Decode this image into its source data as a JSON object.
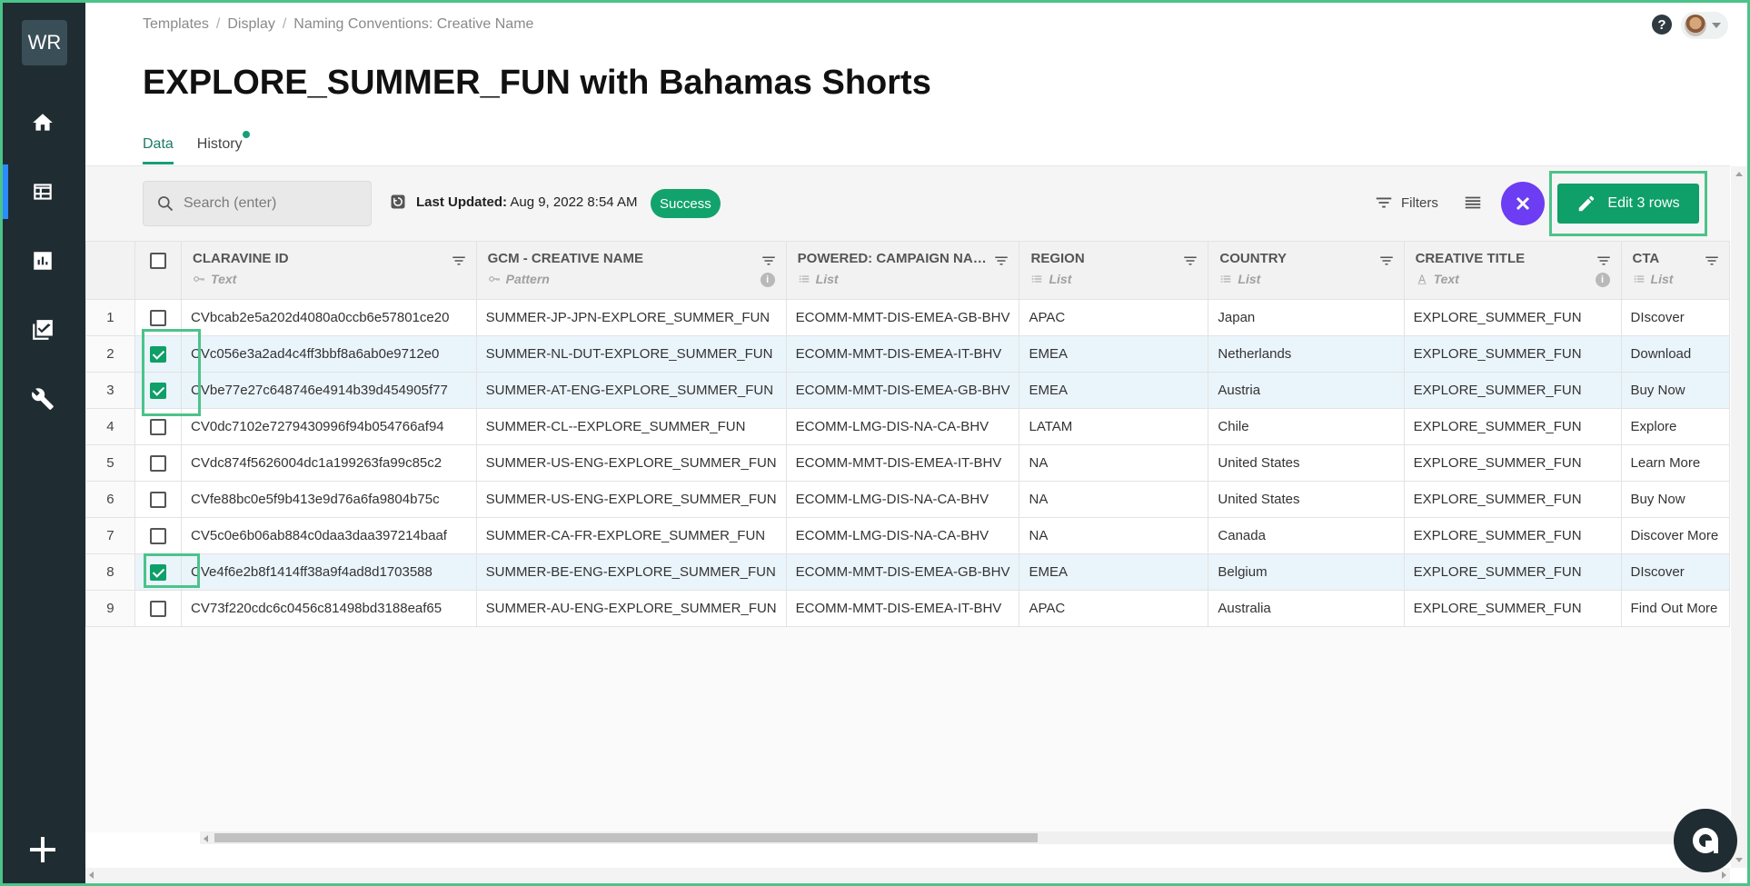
{
  "sidebar": {
    "logo": "WR",
    "items": [
      {
        "name": "home",
        "icon": "home-icon"
      },
      {
        "name": "templates",
        "icon": "table-icon",
        "active": true
      },
      {
        "name": "reports",
        "icon": "bar-chart-icon"
      },
      {
        "name": "approvals",
        "icon": "checklist-icon"
      },
      {
        "name": "settings",
        "icon": "wrench-icon"
      }
    ],
    "add_icon": "plus-icon"
  },
  "header": {
    "breadcrumb": [
      "Templates",
      "Display",
      "Naming Conventions: Creative Name"
    ],
    "title": "EXPLORE_SUMMER_FUN with Bahamas Shorts",
    "tabs": [
      {
        "label": "Data",
        "active": true
      },
      {
        "label": "History",
        "dot": true
      }
    ]
  },
  "toolbar": {
    "search_placeholder": "Search (enter)",
    "last_updated_label": "Last Updated:",
    "last_updated_value": "Aug 9, 2022 8:54 AM",
    "status_badge": "Success",
    "filters_label": "Filters",
    "edit_label": "Edit 3 rows",
    "accent": "#0f9f68",
    "close_color": "#6c3df2"
  },
  "table": {
    "columns": [
      {
        "name": "CLARAVINE ID",
        "type": "Text",
        "type_icon": "key-icon",
        "info": false
      },
      {
        "name": "GCM - CREATIVE NAME",
        "type": "Pattern",
        "type_icon": "key-icon",
        "info": true
      },
      {
        "name": "POWERED: CAMPAIGN NAME",
        "type": "List",
        "type_icon": "list-icon",
        "info": false
      },
      {
        "name": "REGION",
        "type": "List",
        "type_icon": "list-icon",
        "info": false
      },
      {
        "name": "COUNTRY",
        "type": "List",
        "type_icon": "list-icon",
        "info": false
      },
      {
        "name": "CREATIVE TITLE",
        "type": "Text",
        "type_icon": "text-icon",
        "info": true
      },
      {
        "name": "CTA",
        "type": "List",
        "type_icon": "list-icon",
        "info": false
      }
    ],
    "rows": [
      {
        "num": "1",
        "checked": false,
        "cells": [
          "CVbcab2e5a202d4080a0ccb6e57801ce20",
          "SUMMER-JP-JPN-EXPLORE_SUMMER_FUN",
          "ECOMM-MMT-DIS-EMEA-GB-BHV",
          "APAC",
          "Japan",
          "EXPLORE_SUMMER_FUN",
          "DIscover"
        ]
      },
      {
        "num": "2",
        "checked": true,
        "cells": [
          "CVc056e3a2ad4c4ff3bbf8a6ab0e9712e0",
          "SUMMER-NL-DUT-EXPLORE_SUMMER_FUN",
          "ECOMM-MMT-DIS-EMEA-IT-BHV",
          "EMEA",
          "Netherlands",
          "EXPLORE_SUMMER_FUN",
          "Download"
        ]
      },
      {
        "num": "3",
        "checked": true,
        "cells": [
          "CVbe77e27c648746e4914b39d454905f77",
          "SUMMER-AT-ENG-EXPLORE_SUMMER_FUN",
          "ECOMM-MMT-DIS-EMEA-GB-BHV",
          "EMEA",
          "Austria",
          "EXPLORE_SUMMER_FUN",
          "Buy Now"
        ]
      },
      {
        "num": "4",
        "checked": false,
        "cells": [
          "CV0dc7102e7279430996f94b054766af94",
          "SUMMER-CL--EXPLORE_SUMMER_FUN",
          "ECOMM-LMG-DIS-NA-CA-BHV",
          "LATAM",
          "Chile",
          "EXPLORE_SUMMER_FUN",
          "Explore"
        ]
      },
      {
        "num": "5",
        "checked": false,
        "cells": [
          "CVdc874f5626004dc1a199263fa99c85c2",
          "SUMMER-US-ENG-EXPLORE_SUMMER_FUN",
          "ECOMM-MMT-DIS-EMEA-IT-BHV",
          "NA",
          "United States",
          "EXPLORE_SUMMER_FUN",
          "Learn More"
        ]
      },
      {
        "num": "6",
        "checked": false,
        "cells": [
          "CVfe88bc0e5f9b413e9d76a6fa9804b75c",
          "SUMMER-US-ENG-EXPLORE_SUMMER_FUN",
          "ECOMM-LMG-DIS-NA-CA-BHV",
          "NA",
          "United States",
          "EXPLORE_SUMMER_FUN",
          "Buy Now"
        ]
      },
      {
        "num": "7",
        "checked": false,
        "cells": [
          "CV5c0e6b06ab884c0daa3daa397214baaf",
          "SUMMER-CA-FR-EXPLORE_SUMMER_FUN",
          "ECOMM-LMG-DIS-NA-CA-BHV",
          "NA",
          "Canada",
          "EXPLORE_SUMMER_FUN",
          "Discover More"
        ]
      },
      {
        "num": "8",
        "checked": true,
        "cells": [
          "CVe4f6e2b8f1414ff38a9f4ad8d1703588",
          "SUMMER-BE-ENG-EXPLORE_SUMMER_FUN",
          "ECOMM-MMT-DIS-EMEA-GB-BHV",
          "EMEA",
          "Belgium",
          "EXPLORE_SUMMER_FUN",
          "DIscover"
        ]
      },
      {
        "num": "9",
        "checked": false,
        "cells": [
          "CV73f220cdc6c0456c81498bd3188eaf65",
          "SUMMER-AU-ENG-EXPLORE_SUMMER_FUN",
          "ECOMM-MMT-DIS-EMEA-IT-BHV",
          "APAC",
          "Australia",
          "EXPLORE_SUMMER_FUN",
          "Find Out More"
        ]
      }
    ]
  }
}
